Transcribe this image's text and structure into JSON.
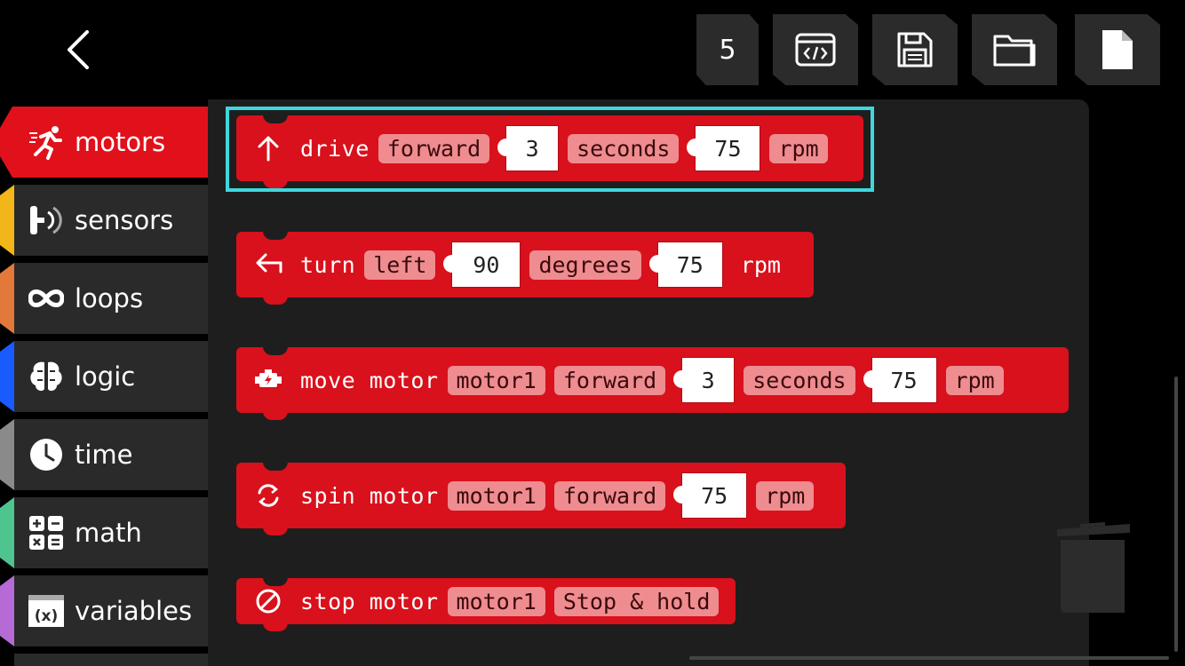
{
  "toolbar": {
    "count": "5",
    "buttons": [
      "code-view",
      "save",
      "open",
      "new-file"
    ]
  },
  "categories": [
    {
      "label": "motors",
      "color": "#e0111b",
      "icon": "running-person-icon"
    },
    {
      "label": "sensors",
      "color": "#f2b51a",
      "icon": "sensor-icon"
    },
    {
      "label": "loops",
      "color": "#e2793a",
      "icon": "loop-icon"
    },
    {
      "label": "logic",
      "color": "#1a5bff",
      "icon": "brain-icon"
    },
    {
      "label": "time",
      "color": "#8a8a8a",
      "icon": "clock-icon"
    },
    {
      "label": "math",
      "color": "#4ec48e",
      "icon": "calculator-icon"
    },
    {
      "label": "variables",
      "color": "#b56ad6",
      "icon": "variable-icon"
    }
  ],
  "blocks": {
    "drive": {
      "label": "drive",
      "direction": "forward",
      "duration": "3",
      "unit": "seconds",
      "speed": "75",
      "speed_unit": "rpm"
    },
    "turn": {
      "label": "turn",
      "direction": "left",
      "amount": "90",
      "unit": "degrees",
      "speed": "75",
      "speed_unit": "rpm"
    },
    "move_motor": {
      "label": "move motor",
      "motor": "motor1",
      "direction": "forward",
      "duration": "3",
      "unit": "seconds",
      "speed": "75",
      "speed_unit": "rpm"
    },
    "spin_motor": {
      "label": "spin motor",
      "motor": "motor1",
      "direction": "forward",
      "speed": "75",
      "speed_unit": "rpm"
    },
    "stop_motor": {
      "label": "stop motor",
      "motor": "motor1",
      "mode": "Stop & hold"
    }
  },
  "colors": {
    "block": "#d8111c",
    "pill": "#ef8c90",
    "selection": "#3fd7dd"
  }
}
